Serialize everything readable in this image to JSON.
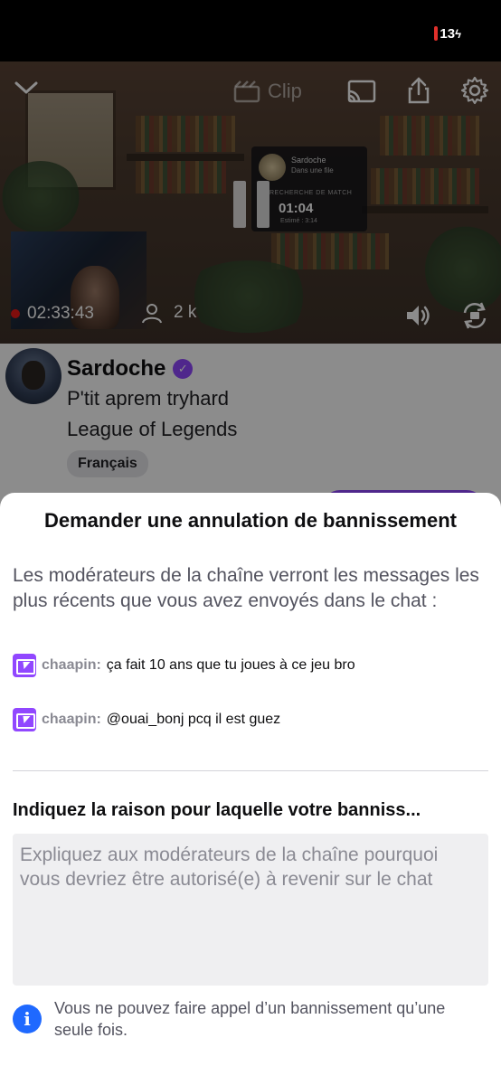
{
  "status_bar": {
    "battery": "13"
  },
  "player": {
    "clip_label": "Clip",
    "live_time": "02:33:43",
    "viewers": "2 k",
    "overlay": {
      "name": "Sardoche",
      "sub": "Dans une file",
      "search_label": "RECHERCHE DE MATCH",
      "timer": "01:04",
      "estimate": "Estimé : 3:14"
    }
  },
  "channel": {
    "name": "Sardoche",
    "title": "P'tit aprem tryhard",
    "game": "League of Legends",
    "tag": "Français"
  },
  "sheet": {
    "title": "Demander une annulation de bannissement",
    "description": "Les modérateurs de la chaîne verront les messages les plus récents que vous avez envoyés dans le chat :",
    "messages": [
      {
        "user": "chaapin:",
        "text": "ça fait 10 ans que tu joues à ce jeu bro"
      },
      {
        "user": "chaapin:",
        "text": "@ouai_bonj pcq il est guez"
      }
    ],
    "reason_label": "Indiquez la raison pour laquelle votre banniss...",
    "reason_placeholder": "Expliquez aux modérateurs de la chaîne pourquoi vous devriez être autorisé(e) à revenir sur le chat",
    "info": "Vous ne pouvez faire appel d’un bannissement qu’une seule fois."
  },
  "colors": {
    "accent": "#9147ff",
    "live": "#e91916",
    "info": "#1f69ff"
  }
}
